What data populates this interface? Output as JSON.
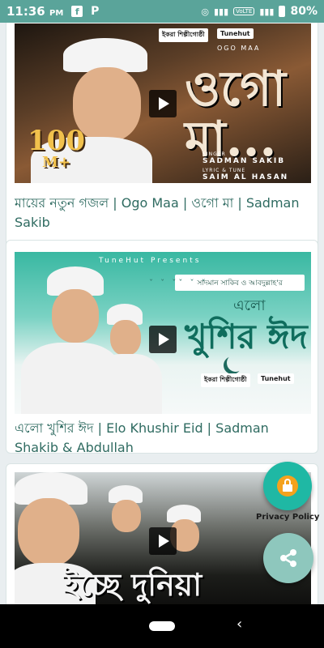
{
  "status_bar": {
    "time": "11:36",
    "ampm": "PM",
    "left_icons": [
      "facebook-icon",
      "p-icon"
    ],
    "volte": "VoLTE",
    "battery": "80%"
  },
  "videos": [
    {
      "title": "মায়ের নতুন গজল | Ogo Maa | ওগো মা | Sadman Sakib",
      "thumb": {
        "badge": "100",
        "badge_suffix": "M+",
        "heading": "ওগো মা...",
        "heading_en": "OGO MAA",
        "logo1": "ইকরা শিল্পীগোষ্ঠী",
        "logo2": "Tunehut",
        "singer_label": "SINGER",
        "singer": "SADMAN SAKIB",
        "lyric_label": "LYRIC & TUNE",
        "lyricist": "SAIM AL HASAN"
      }
    },
    {
      "title": "এলো খুশির ঈদ | Elo Khushir Eid | Sadman Shakib & Abdullah",
      "thumb": {
        "presents": "TuneHut Presents",
        "artists": "সাদমান সাকিব ও আবদুল্লাহ'র",
        "elo": "এলো",
        "khushir": "খুশির ঈদ",
        "logo1": "ইকরা শিল্পীগোষ্ঠী",
        "logo2": "Tunehut"
      }
    },
    {
      "title": "",
      "thumb": {
        "heading": "ইচ্ছে দুনিয়া"
      }
    }
  ],
  "fabs": {
    "privacy_label": "Privacy Policy",
    "privacy_icon": "lock-icon",
    "share_icon": "share-icon"
  },
  "colors": {
    "status_bar": "#5aa49a",
    "title_text": "#2f6b61",
    "privacy_fab": "#1fb8a4",
    "share_fab": "#8ec7bd"
  }
}
